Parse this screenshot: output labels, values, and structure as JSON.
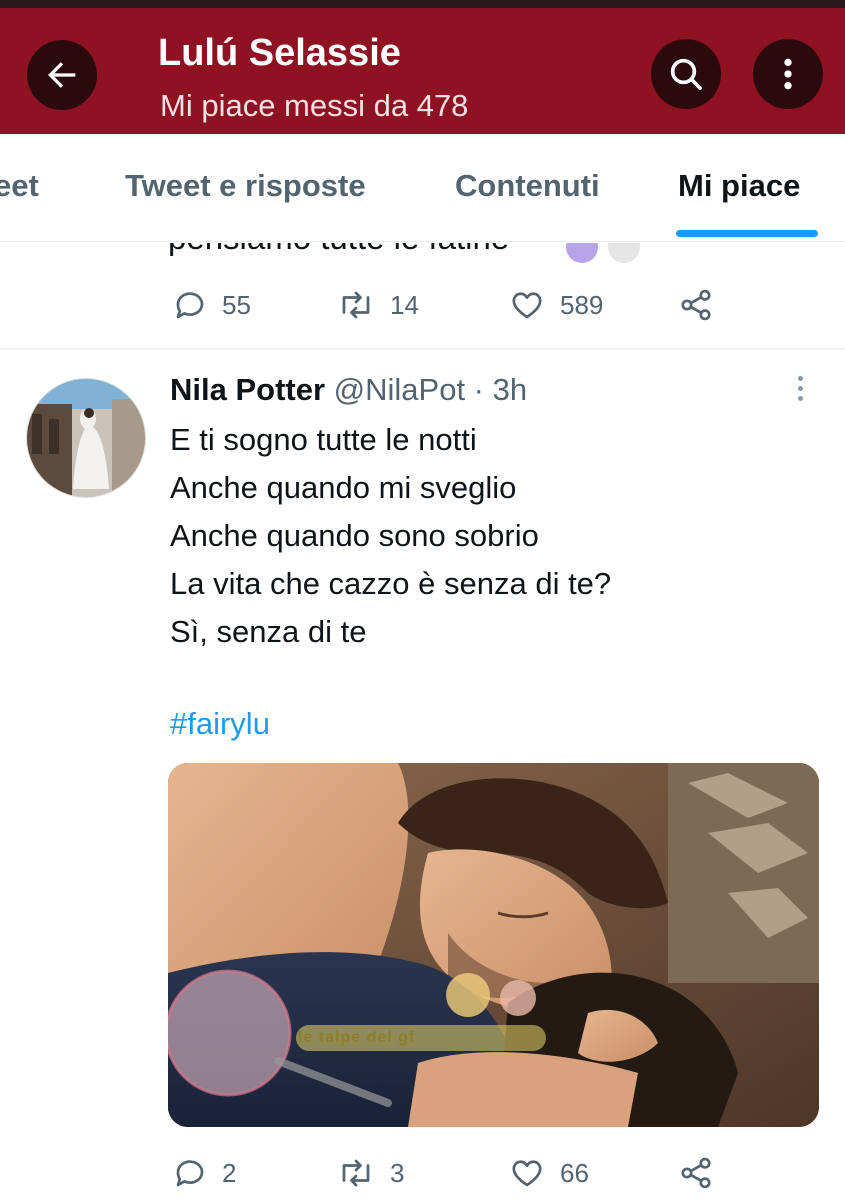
{
  "header": {
    "title": "Lulú Selassie",
    "subtitle": "Mi piace messi da 478",
    "back_icon": "back-arrow-icon",
    "search_icon": "search-icon",
    "more_icon": "more-vertical-icon",
    "color": "#8f1223"
  },
  "tabs": [
    {
      "label": "eet"
    },
    {
      "label": "Tweet e risposte"
    },
    {
      "label": "Contenuti"
    },
    {
      "label": "Mi piace",
      "active": true
    }
  ],
  "previous_tweet": {
    "text_fragment": "pensiamo tutte le fatine",
    "replies": "55",
    "retweets": "14",
    "likes": "589"
  },
  "tweet": {
    "author_name": "Nila Potter",
    "author_meta": "@NilaPot · 3h",
    "lines": [
      "E ti sogno tutte le notti",
      "Anche quando mi sveglio",
      "Anche quando sono sobrio",
      "La vita che cazzo è senza di te?",
      "Sì, senza di te"
    ],
    "hashtag": "#fairylu",
    "replies": "2",
    "retweets": "3",
    "likes": "66"
  },
  "watermark": {
    "text": "le talpe del gf",
    "logo_text": "Vicolo delle News"
  },
  "colors": {
    "accent": "#1d9bf0",
    "secondary_text": "#536471"
  }
}
